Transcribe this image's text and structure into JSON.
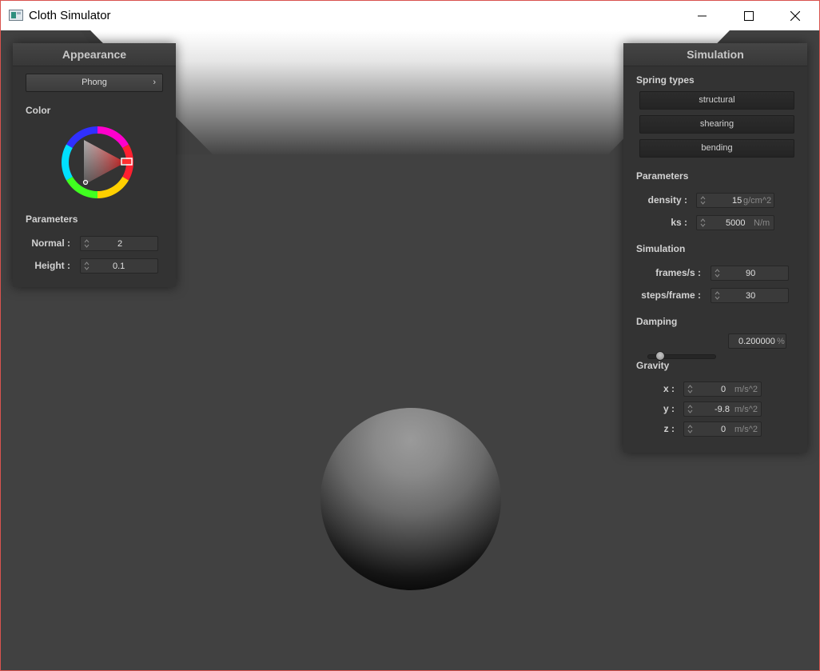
{
  "window": {
    "title": "Cloth Simulator",
    "icon": "app-window-icon",
    "controls": [
      "minimize-icon",
      "maximize-icon",
      "close-icon"
    ]
  },
  "appearance": {
    "title": "Appearance",
    "shader_selected": "Phong",
    "dropdown_chevron": "›",
    "color_label": "Color",
    "parameters_label": "Parameters",
    "normal_label": "Normal :",
    "normal_value": "2",
    "height_label": "Height :",
    "height_value": "0.1"
  },
  "simulation": {
    "title": "Simulation",
    "spring_types_label": "Spring types",
    "spring_buttons": [
      "structural",
      "shearing",
      "bending"
    ],
    "parameters_label": "Parameters",
    "density_label": "density :",
    "density_value": "15",
    "density_unit": "g/cm^2",
    "ks_label": "ks :",
    "ks_value": "5000",
    "ks_unit": "N/m",
    "simulation_label": "Simulation",
    "fps_label": "frames/s :",
    "fps_value": "90",
    "steps_label": "steps/frame :",
    "steps_value": "30",
    "damping_label": "Damping",
    "damping_value": "0.200000",
    "damping_unit": "%",
    "damping_slider_fraction": 0.2,
    "gravity_label": "Gravity",
    "gx_label": "x :",
    "gx_value": "0",
    "gy_label": "y :",
    "gy_value": "-9.8",
    "gz_label": "z :",
    "gz_value": "0",
    "gravity_unit": "m/s^2"
  },
  "colors": {
    "viewport_bg": "#414141",
    "panel_bg": "#333333",
    "selected_color": "#ff3030",
    "title_bar_border": "#d9534f"
  }
}
